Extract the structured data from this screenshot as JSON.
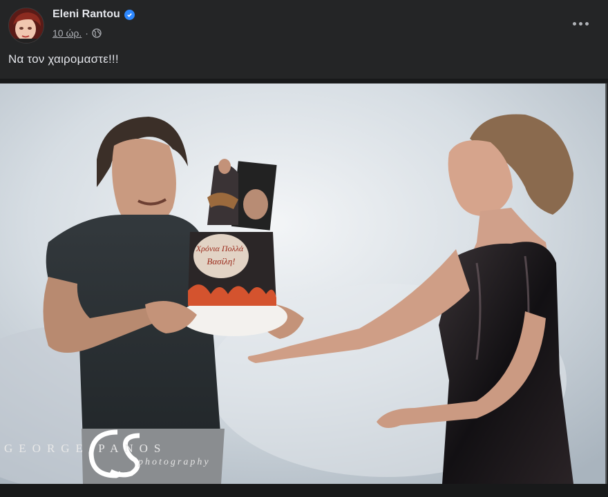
{
  "post": {
    "author": "Eleni Rantou",
    "verified_icon": "verified-badge-icon",
    "time": "10 ώρ.",
    "separator": "·",
    "audience_icon": "globe-icon",
    "more_icon": "more-options-icon",
    "caption": "Να τον χαιρομαστε!!!"
  },
  "photo": {
    "watermark_name": "GEORGE PANOS",
    "watermark_sub": "photography",
    "cake_text_1": "Χρόνια Πολλά",
    "cake_text_2": "Βασίλη!"
  },
  "colors": {
    "background": "#242526",
    "text_primary": "#e4e6eb",
    "text_secondary": "#b0b3b8",
    "verified": "#2d88ff"
  }
}
